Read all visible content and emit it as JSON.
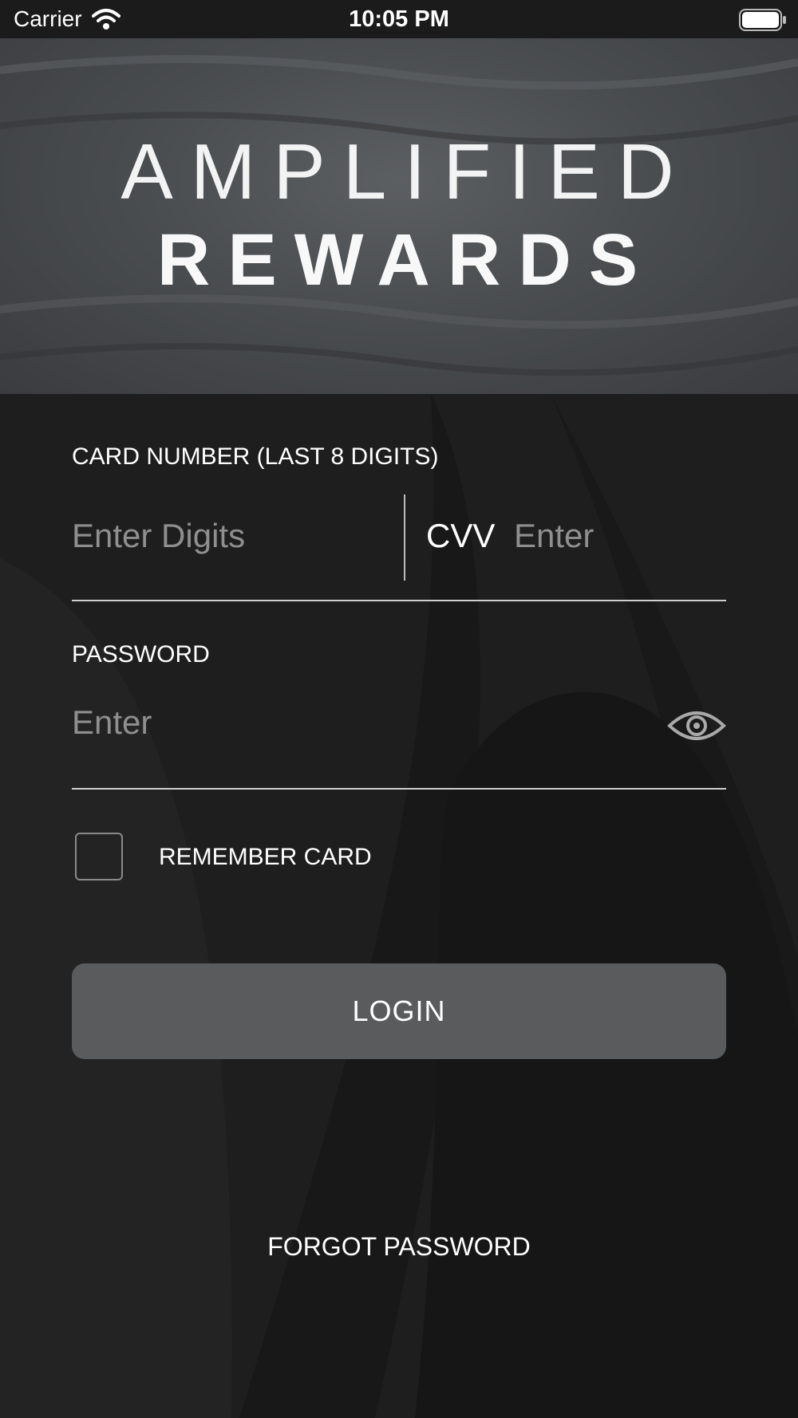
{
  "status_bar": {
    "carrier": "Carrier",
    "time": "10:05 PM",
    "wifi_icon": "wifi-icon",
    "battery_icon": "battery-icon"
  },
  "hero": {
    "line1": "AMPLIFIED",
    "line2": "REWARDS"
  },
  "form": {
    "card_label": "CARD NUMBER (LAST 8 DIGITS)",
    "card_placeholder": "Enter Digits",
    "cvv_label": "CVV",
    "cvv_placeholder": "Enter",
    "password_label": "PASSWORD",
    "password_placeholder": "Enter",
    "eye_icon": "eye-icon",
    "remember_label": "REMEMBER CARD",
    "remember_checked": false,
    "login_label": "LOGIN",
    "forgot_label": "FORGOT PASSWORD"
  },
  "colors": {
    "background": "#1e1e1e",
    "button": "#5a5b5c",
    "placeholder": "#8f8f8f",
    "text": "#ffffff"
  }
}
